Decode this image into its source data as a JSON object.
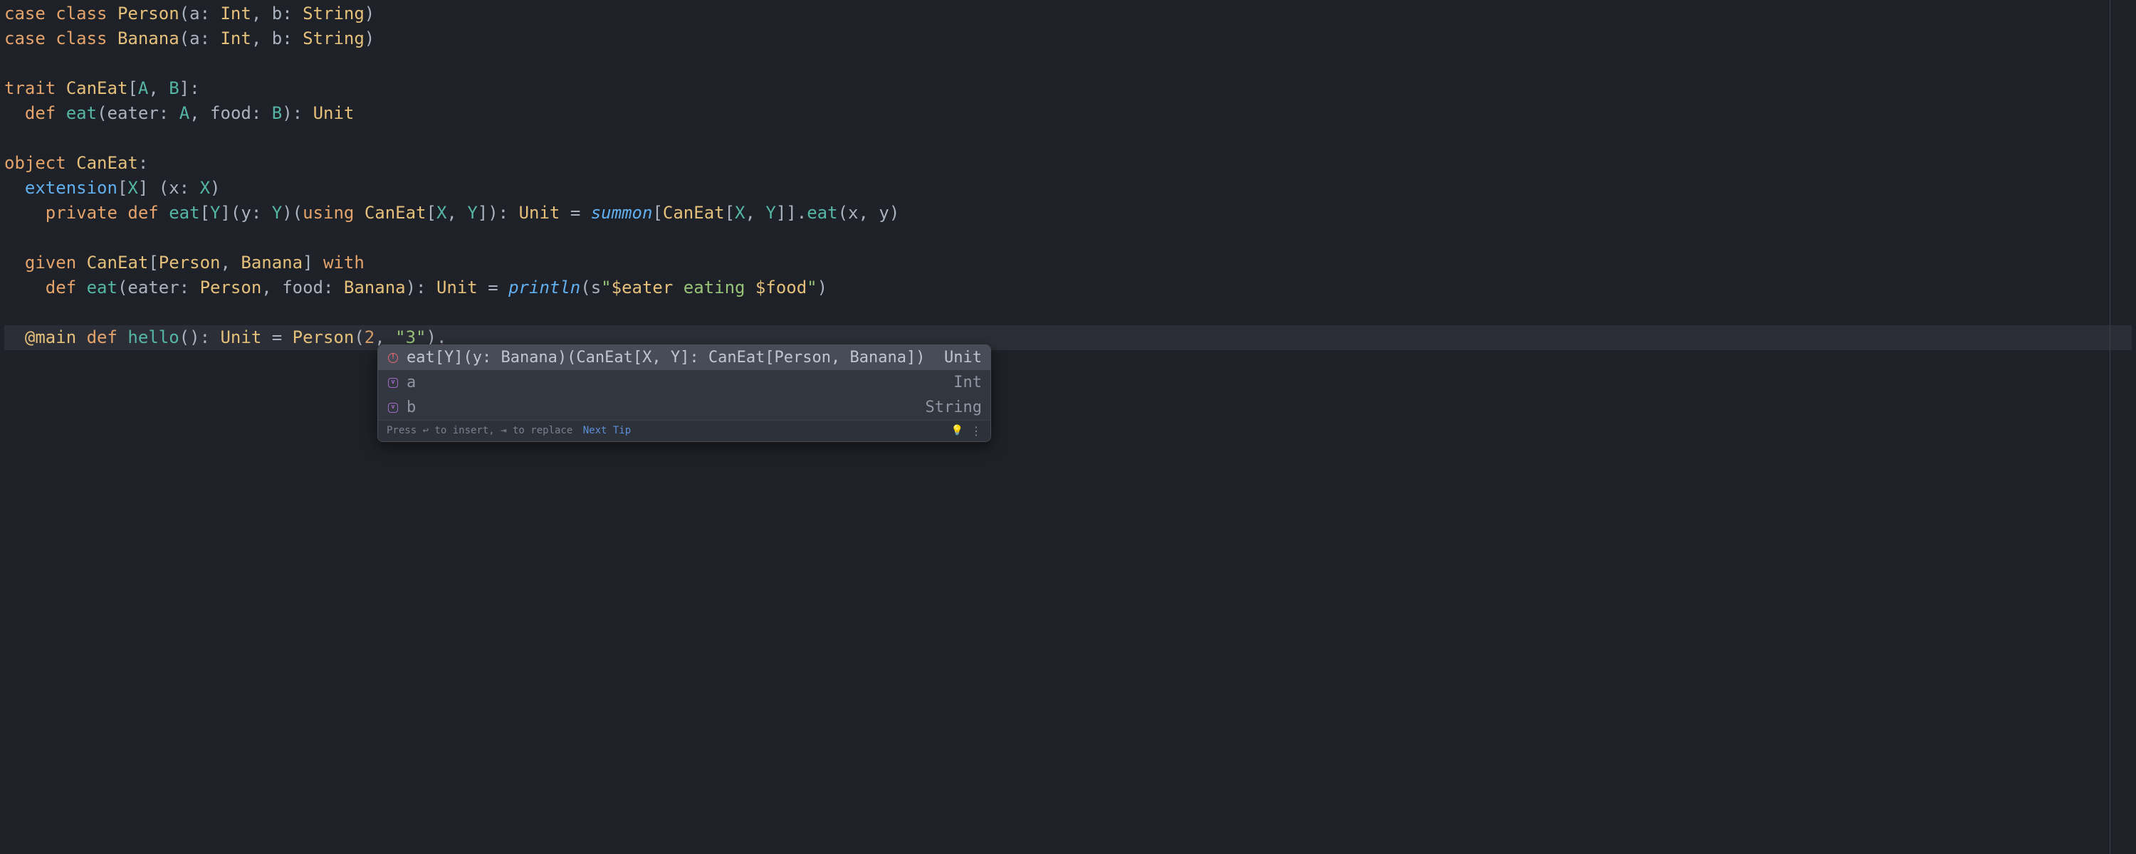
{
  "colors": {
    "background": "#1e2127",
    "foreground": "#abb2bf",
    "keyword": "#c678dd",
    "class": "#e5c07b",
    "function": "#61afef",
    "string": "#98c379",
    "number": "#d19a66",
    "type_param": "#55b6a5",
    "popup_bg": "#32363f",
    "popup_selected": "#474c56"
  },
  "code": {
    "line1": {
      "kw1": "case",
      "kw2": "class",
      "name": "Person",
      "p1": "a",
      "t1": "Int",
      "p2": "b",
      "t2": "String"
    },
    "line2": {
      "kw1": "case",
      "kw2": "class",
      "name": "Banana",
      "p1": "a",
      "t1": "Int",
      "p2": "b",
      "t2": "String"
    },
    "line4": {
      "kw1": "trait",
      "name": "CanEat",
      "tp1": "A",
      "tp2": "B"
    },
    "line5": {
      "kw1": "def",
      "fn": "eat",
      "p1": "eater",
      "tp1": "A",
      "p2": "food",
      "tp2": "B",
      "ret": "Unit"
    },
    "line7": {
      "kw1": "object",
      "name": "CanEat"
    },
    "line8": {
      "kw1": "extension",
      "tp": "X",
      "p": "x",
      "pt": "X"
    },
    "line9": {
      "kw1": "private",
      "kw2": "def",
      "fn": "eat",
      "tp": "Y",
      "p": "y",
      "pt": "Y",
      "kw3": "using",
      "cls": "CanEat",
      "tpx": "X",
      "tpy": "Y",
      "ret": "Unit",
      "call": "summon",
      "cls2": "CanEat",
      "tpx2": "X",
      "tpy2": "Y",
      "method": "eat",
      "arg1": "x",
      "arg2": "y"
    },
    "line11": {
      "kw1": "given",
      "cls": "CanEat",
      "t1": "Person",
      "t2": "Banana",
      "kw2": "with"
    },
    "line12": {
      "kw1": "def",
      "fn": "eat",
      "p1": "eater",
      "t1": "Person",
      "p2": "food",
      "t2": "Banana",
      "ret": "Unit",
      "call": "println",
      "prefix": "s",
      "str1": "\"",
      "interp1": "$eater",
      "str2": " eating ",
      "interp2": "$food",
      "str3": "\""
    },
    "line14": {
      "anno": "@main",
      "kw1": "def",
      "fn": "hello",
      "ret": "Unit",
      "cls": "Person",
      "arg1": "2",
      "arg2": "\"3\"",
      "err": "."
    }
  },
  "autocomplete": {
    "items": [
      {
        "icon": "error-method",
        "name": "eat[Y](y: Banana)(CanEat[X, Y]: CanEat[Person, Banana])",
        "type": "Unit",
        "selected": true
      },
      {
        "icon": "field",
        "name": "a",
        "type": "Int",
        "selected": false
      },
      {
        "icon": "field",
        "name": "b",
        "type": "String",
        "selected": false
      }
    ],
    "footer": {
      "text": "Press ↩ to insert, ⇥ to replace",
      "link": "Next Tip"
    }
  }
}
